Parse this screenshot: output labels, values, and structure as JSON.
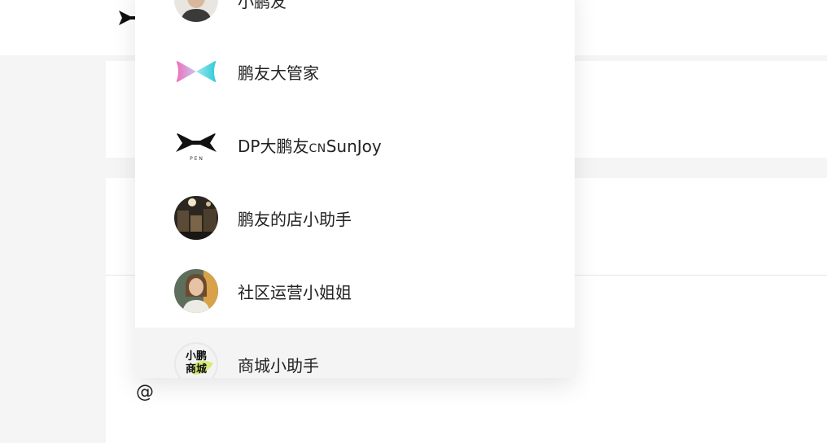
{
  "mention_list": {
    "items": [
      {
        "name": "小鹏友",
        "avatar": "person-photo-avatar"
      },
      {
        "name": "鹏友大管家",
        "avatar": "gradient-bow-logo-avatar"
      },
      {
        "name_main": "DP大鹏友",
        "name_small": "CN",
        "name_tail": "SunJoy",
        "avatar": "xpeng-logo-avatar",
        "avatar_caption": "P E N"
      },
      {
        "name": "鹏友的店小助手",
        "avatar": "shop-interior-photo-avatar"
      },
      {
        "name": "社区运营小姐姐",
        "avatar": "woman-portrait-avatar"
      },
      {
        "name": "商城小助手",
        "avatar": "mall-logo-avatar",
        "avatar_text_line1": "小鹏",
        "avatar_text_line2": "商城"
      }
    ],
    "selected_index": 5
  },
  "editor": {
    "typed_text": "@"
  },
  "colors": {
    "background": "#f5f5f5",
    "panel": "#ffffff",
    "selected_row": "#f4f4f4",
    "text": "#222222"
  }
}
